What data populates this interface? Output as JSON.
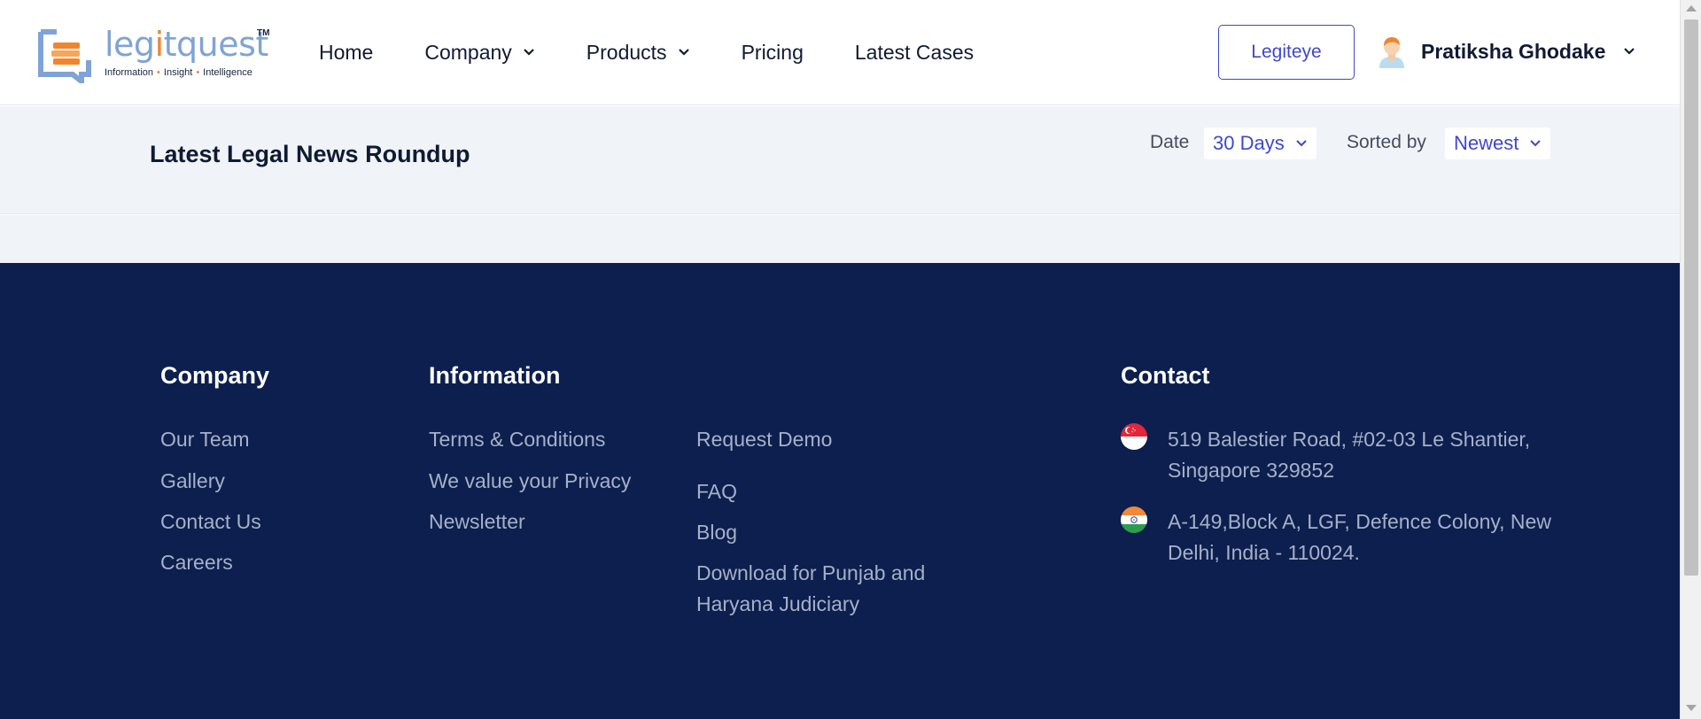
{
  "header": {
    "logo": {
      "word_a": "leg",
      "word_i": "i",
      "word_b": "tquest",
      "tm": "TM",
      "tagline": [
        "Information",
        "Insight",
        "Intelligence"
      ]
    },
    "nav": [
      {
        "label": "Home",
        "has_dropdown": false
      },
      {
        "label": "Company",
        "has_dropdown": true
      },
      {
        "label": "Products",
        "has_dropdown": true
      },
      {
        "label": "Pricing",
        "has_dropdown": false
      },
      {
        "label": "Latest Cases",
        "has_dropdown": false
      }
    ],
    "legiteye_button": "Legiteye",
    "user_name": "Pratiksha Ghodake"
  },
  "filters": {
    "page_title": "Latest Legal News Roundup",
    "date_label": "Date",
    "date_value": "30 Days",
    "sort_label": "Sorted by",
    "sort_value": "Newest"
  },
  "footer": {
    "company_heading": "Company",
    "company_links": [
      "Our Team",
      "Gallery",
      "Contact Us",
      "Careers"
    ],
    "information_heading": "Information",
    "info_links_col1": [
      "Terms & Conditions",
      "We value your Privacy",
      "Newsletter"
    ],
    "info_links_col2": [
      "Request Demo",
      "FAQ",
      "Blog",
      "Download for Punjab and Haryana Judiciary"
    ],
    "contact_heading": "Contact",
    "addresses": [
      {
        "flag": "singapore-flag-icon",
        "text": "519 Balestier Road, #02-03 Le Shantier, Singapore 329852"
      },
      {
        "flag": "india-flag-icon",
        "text": "A-149,Block A, LGF, Defence Colony, New Delhi, India - 110024."
      }
    ]
  },
  "colors": {
    "accent": "#3f47cf",
    "footer_bg": "#0c1f4e",
    "band_bg": "#f0f3f8",
    "logo_blue": "#7fa3d6",
    "logo_orange": "#f0852e"
  }
}
